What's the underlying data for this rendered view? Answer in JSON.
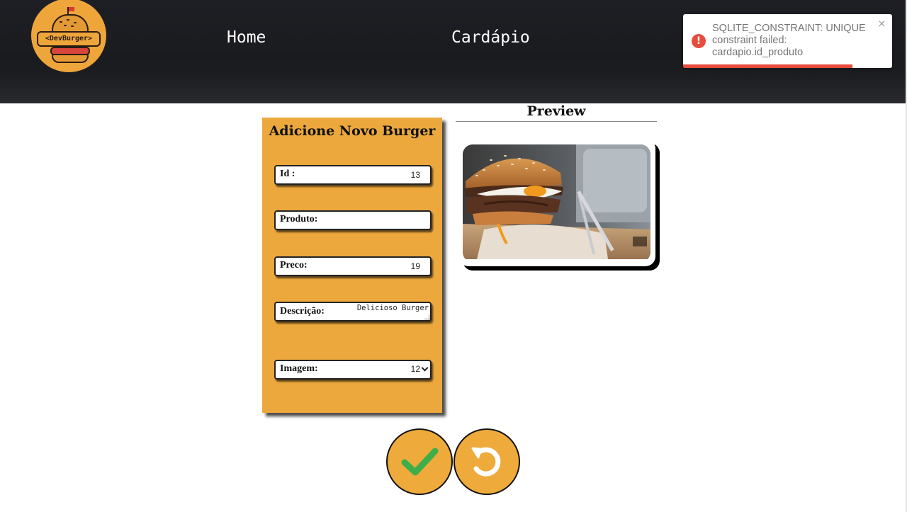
{
  "header": {
    "logo_text": "<DevBurger>",
    "nav": [
      {
        "label": "Home"
      },
      {
        "label": "Cardápio"
      }
    ]
  },
  "toast": {
    "message": "SQLITE_CONSTRAINT: UNIQUE constraint failed: cardapio.id_produto",
    "close": "×",
    "icon": "error-icon",
    "progress_fraction": 0.81,
    "accent": "#e74c3c"
  },
  "form": {
    "title": "Adicione Novo Burger",
    "fields": {
      "id": {
        "label": "Id :",
        "value": "13"
      },
      "produto": {
        "label": "Produto:",
        "value": ""
      },
      "preco": {
        "label": "Preco:",
        "value": "19"
      },
      "descricao": {
        "label": "Descrição:",
        "value": "Delicioso Burger"
      },
      "imagem": {
        "label": "Imagem:",
        "value": "12"
      }
    }
  },
  "preview": {
    "title": "Preview",
    "image_icon": "burger-photo"
  },
  "actions": {
    "confirm_icon": "check-icon",
    "reset_icon": "undo-icon"
  },
  "colors": {
    "header_bg": "#1e1f24",
    "card_bg": "#eca83c",
    "button_bg": "#eeab3b",
    "check_green": "#3fae49"
  }
}
